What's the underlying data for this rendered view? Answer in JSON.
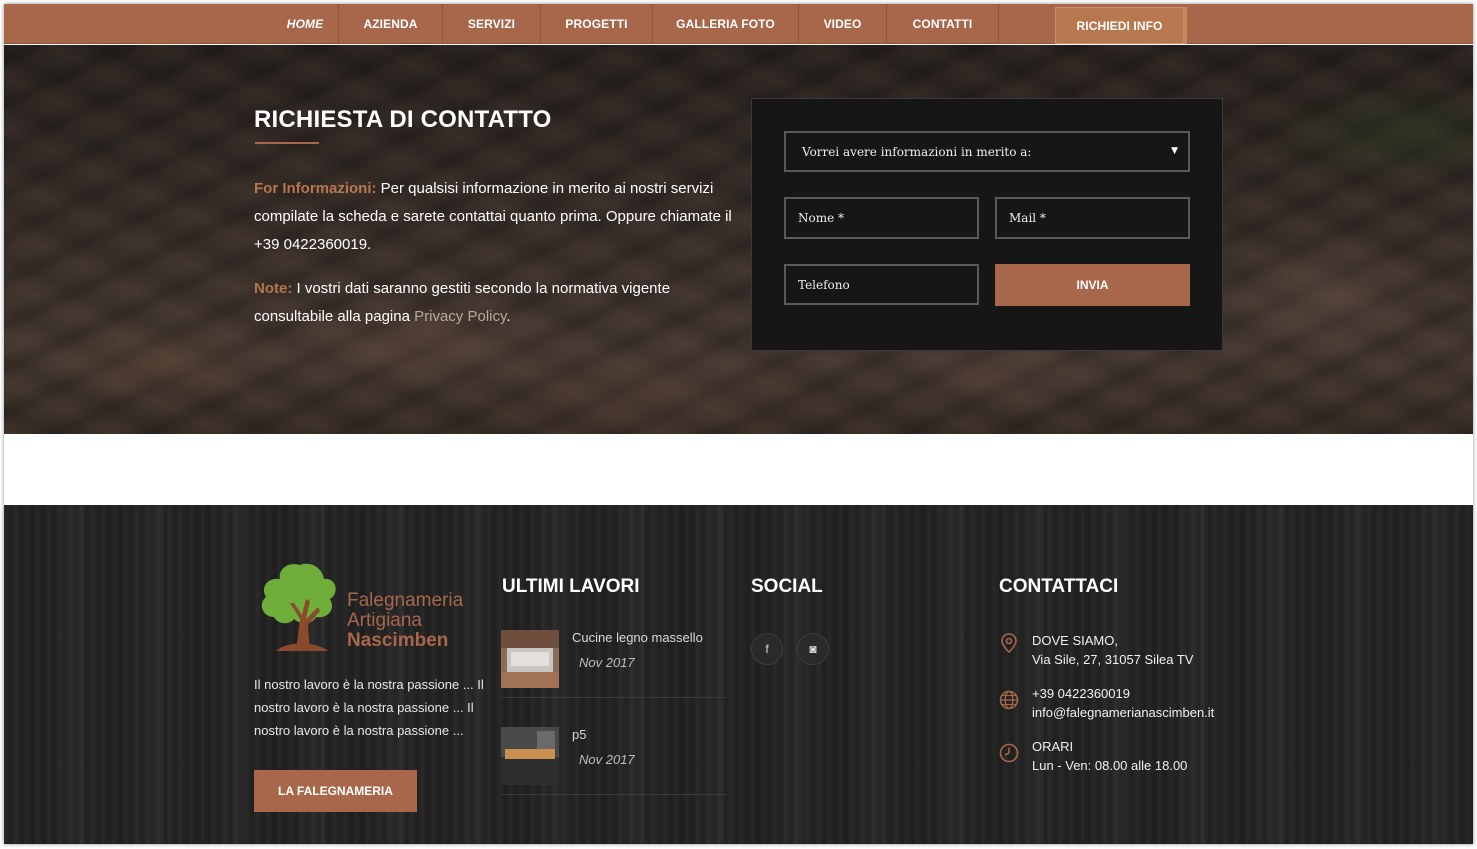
{
  "nav": {
    "items": [
      {
        "label": "HOME"
      },
      {
        "label": "AZIENDA"
      },
      {
        "label": "SERVIZI"
      },
      {
        "label": "PROGETTI"
      },
      {
        "label": "GALLERIA FOTO"
      },
      {
        "label": "VIDEO"
      },
      {
        "label": "CONTATTI"
      }
    ],
    "cta_label": "RICHIEDI INFO"
  },
  "contact": {
    "title": "RICHIESTA DI CONTATTO",
    "info_label": "For Informazioni:",
    "info_text": " Per qualsisi informazione in merito ai nostri servizi compilate la scheda e sarete contattai quanto prima. Oppure chiamate il +39 0422360019.",
    "note_label": "Note:",
    "note_text": " I vostri dati saranno gestiti secondo la normativa vigente consultabile alla pagina ",
    "privacy_link": "Privacy Policy",
    "note_end": "."
  },
  "form": {
    "select_value": "Vorrei avere informazioni in merito a:",
    "name_placeholder": "Nome *",
    "mail_placeholder": "Mail *",
    "phone_placeholder": "Telefono",
    "submit_label": "INVIA"
  },
  "footer": {
    "logo_line1": "Falegnameria",
    "logo_line2": "Artigiana",
    "logo_line3": "Nascimben",
    "about": "Il nostro lavoro è la nostra passione ... Il nostro lavoro è la nostra passione ... Il nostro lavoro è la nostra passione ...",
    "about_button": "LA FALEGNAMERIA",
    "works_heading": "ULTIMI LAVORI",
    "works": [
      {
        "title": "Cucine legno massello",
        "date": "Nov 2017"
      },
      {
        "title": "p5",
        "date": "Nov 2017"
      }
    ],
    "social_heading": "SOCIAL",
    "social": [
      {
        "icon": "facebook-icon",
        "glyph": "f"
      },
      {
        "icon": "instagram-icon",
        "glyph": "◙"
      }
    ],
    "contact_heading": "CONTATTACI",
    "where_label": "DOVE SIAMO,",
    "address": "Via Sile, 27, 31057 Silea TV",
    "phone": "+39 0422360019",
    "email": "info@falegnamerianascimben.it",
    "hours_label": "ORARI",
    "hours": "Lun - Ven: 08.00 alle 18.00"
  },
  "colors": {
    "accent": "#a8674a",
    "nav_bg": "#a8674a",
    "footer_bg": "#252525",
    "form_bg": "#161616"
  }
}
